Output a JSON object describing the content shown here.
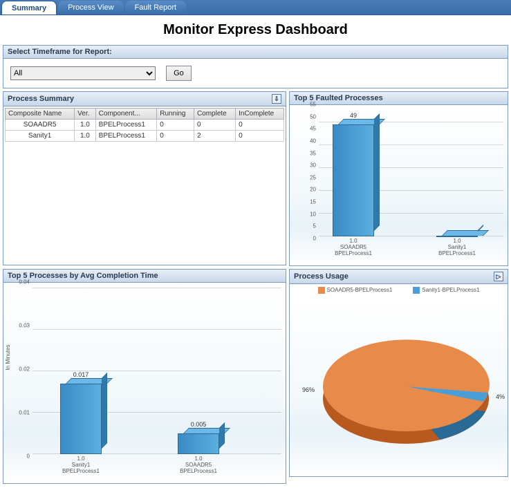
{
  "tabs": {
    "summary": "Summary",
    "process_view": "Process View",
    "fault_report": "Fault Report"
  },
  "page_title": "Monitor Express Dashboard",
  "timeframe": {
    "label": "Select Timeframe for Report:",
    "selected": "All",
    "go": "Go"
  },
  "process_summary": {
    "title": "Process Summary",
    "columns": [
      "Composite Name",
      "Ver.",
      "Component...",
      "Running",
      "Complete",
      "InComplete"
    ],
    "rows": [
      {
        "composite": "SOAADR5",
        "ver": "1.0",
        "component": "BPELProcess1",
        "running": 0,
        "complete": 0,
        "incomplete": 0
      },
      {
        "composite": "Sanity1",
        "ver": "1.0",
        "component": "BPELProcess1",
        "running": 0,
        "complete": 2,
        "incomplete": 0
      }
    ]
  },
  "faulted": {
    "title": "Top 5 Faulted Processes"
  },
  "avg_time": {
    "title": "Top 5 Processes by Avg Completion Time",
    "ylabel": "In Minutes"
  },
  "usage": {
    "title": "Process Usage",
    "legend": [
      "SOAADR5-BPELProcess1",
      "Sanity1-BPELProcess1"
    ],
    "labels": [
      "96%",
      "4%"
    ]
  },
  "chart_data": [
    {
      "id": "top5_faulted",
      "type": "bar",
      "categories": [
        "1.0 SOAADR5 BPELProcess1",
        "1.0 Sanity1 BPELProcess1"
      ],
      "values": [
        49,
        0
      ],
      "ylim": [
        0,
        55
      ],
      "y_ticks": [
        0,
        5,
        10,
        15,
        20,
        25,
        30,
        35,
        40,
        45,
        50,
        55
      ]
    },
    {
      "id": "top5_avg_completion",
      "type": "bar",
      "categories": [
        "1.0 Sanity1 BPELProcess1",
        "1.0 SOAADR5 BPELProcess1"
      ],
      "values": [
        0.017,
        0.005
      ],
      "ylabel": "In Minutes",
      "ylim": [
        0,
        0.04
      ],
      "y_ticks": [
        0,
        0.01,
        0.02,
        0.03,
        0.04
      ]
    },
    {
      "id": "process_usage",
      "type": "pie",
      "series": [
        {
          "name": "SOAADR5-BPELProcess1",
          "value": 96,
          "color": "#e88b4a"
        },
        {
          "name": "Sanity1-BPELProcess1",
          "value": 4,
          "color": "#4a9ed8"
        }
      ]
    }
  ],
  "x_labels": {
    "faulted": [
      {
        "l1": "1.0",
        "l2": "SOAADR5",
        "l3": "BPELProcess1"
      },
      {
        "l1": "1.0",
        "l2": "Sanity1",
        "l3": "BPELProcess1"
      }
    ],
    "avg": [
      {
        "l1": "1.0",
        "l2": "Sanity1",
        "l3": "BPELProcess1"
      },
      {
        "l1": "1.0",
        "l2": "SOAADR5",
        "l3": "BPELProcess1"
      }
    ]
  }
}
